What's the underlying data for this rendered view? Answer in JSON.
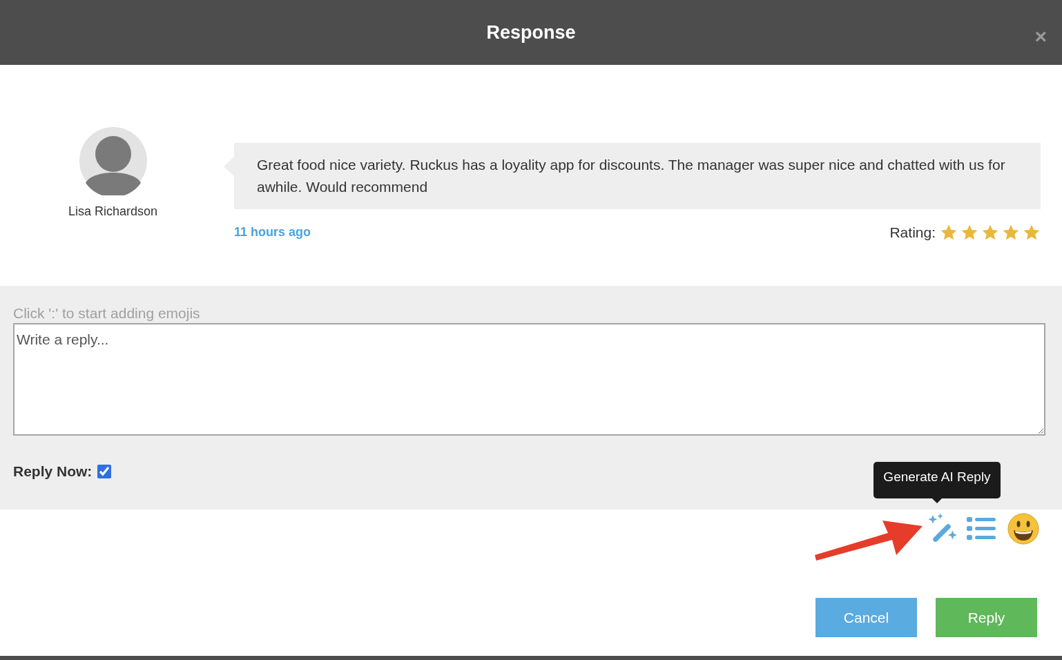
{
  "dialog": {
    "title": "Response",
    "close": "×"
  },
  "review": {
    "author": "Lisa Richardson",
    "text": "Great food nice variety. Ruckus has a loyality app for discounts. The manager was super nice and chatted with us for awhile. Would recommend",
    "time": "11 hours ago",
    "rating_label": "Rating:",
    "stars": 5
  },
  "reply": {
    "hint": "Click ':' to start adding emojis",
    "placeholder": "Write a reply...",
    "reply_now_label": "Reply Now:",
    "reply_now_checked": true
  },
  "tooltip": "Generate AI Reply",
  "buttons": [
    {
      "label": "Cancel",
      "kind": "cancel"
    },
    {
      "label": "Reply",
      "kind": "primary"
    }
  ]
}
